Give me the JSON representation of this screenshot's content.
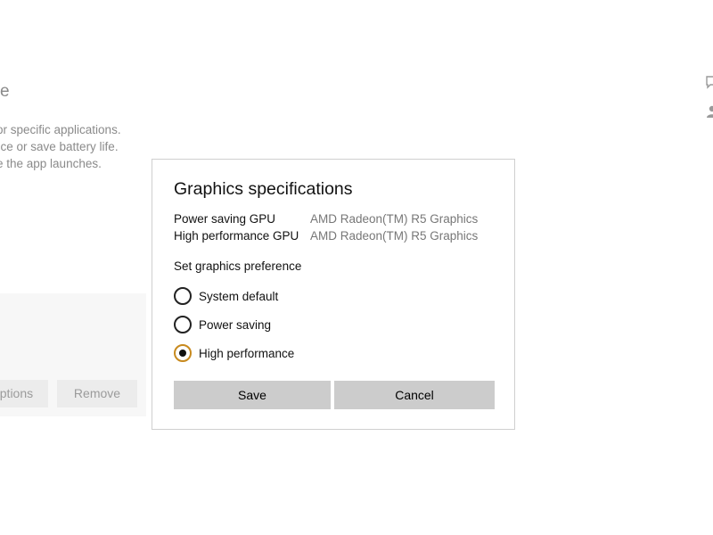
{
  "background": {
    "heading_fragment": "e",
    "description_lines": [
      "or specific applications.",
      "nce or save battery life.",
      "e the app launches."
    ],
    "options_button_label": "Options",
    "remove_button_label": "Remove"
  },
  "dialog": {
    "title": "Graphics specifications",
    "specs": [
      {
        "label": "Power saving GPU",
        "value": "AMD Radeon(TM) R5 Graphics"
      },
      {
        "label": "High performance GPU",
        "value": "AMD Radeon(TM) R5 Graphics"
      }
    ],
    "preference_label": "Set graphics preference",
    "options": [
      {
        "label": "System default",
        "checked": false
      },
      {
        "label": "Power saving",
        "checked": false
      },
      {
        "label": "High performance",
        "checked": true
      }
    ],
    "save_label": "Save",
    "cancel_label": "Cancel",
    "accent_color": "#c88a1e"
  }
}
